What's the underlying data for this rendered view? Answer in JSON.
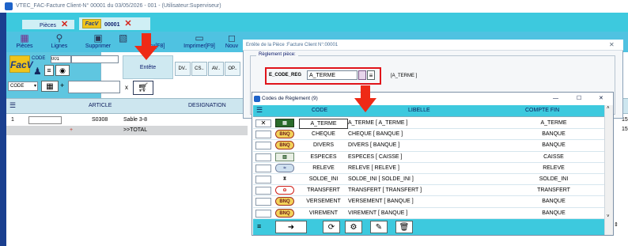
{
  "window": {
    "title": "VTEC_FAC-Facture Client-N° 00001 du 03/05/2026 - 001 - (Utilisateur:Superviseur)"
  },
  "tabs": [
    {
      "label": "Pièces"
    },
    {
      "label": "00001"
    }
  ],
  "toolbar": {
    "items": [
      {
        "label": "Pièces",
        "icon": "grid-icon"
      },
      {
        "label": "Lignes",
        "icon": "search-icon"
      },
      {
        "label": "Supprimer",
        "icon": "delete-icon"
      },
      {
        "label": "Reçu[F8]",
        "icon": "receipt-icon"
      },
      {
        "label": "Imprimer[F9]",
        "icon": "printer-icon"
      },
      {
        "label": "Nouv",
        "icon": "new-icon"
      }
    ]
  },
  "header_form": {
    "code_label": "CODE",
    "code_value": "001",
    "entete_label": "Entête",
    "mini_buttons": [
      "DV..",
      "CS..",
      "AV..",
      "OP.."
    ],
    "code_dropdown": "CODE"
  },
  "grid": {
    "columns": [
      "ARTICLE",
      "DESIGNATION"
    ],
    "rows": [
      {
        "num": "1",
        "article": "S0308",
        "designation": "Sable 3-8"
      },
      {
        "num": "",
        "article": "",
        "designation": ">>TOTAL"
      }
    ],
    "right_values": [
      "15",
      "15"
    ]
  },
  "entete_dialog": {
    "title": "Entête de la Pièce :Facture Client N°:00001",
    "section": "Règlement pièce:",
    "field_label": "E_CODE_REG",
    "field_value": "A_TERME",
    "field_display": "[A_TERME ]"
  },
  "codes_dialog": {
    "title": "Codes de Règlement (9)",
    "columns": [
      "CODE",
      "LIBELLE",
      "COMPTE FIN"
    ],
    "rows": [
      {
        "icon": "card-icon",
        "code": "A_TERME",
        "libelle": "A_TERME [ A_TERME ]",
        "compte": "A_TERME"
      },
      {
        "icon": "bnq-icon",
        "code": "CHEQUE",
        "libelle": "CHEQUE [ BANQUE ]",
        "compte": "BANQUE"
      },
      {
        "icon": "bnq-icon",
        "code": "DIVERS",
        "libelle": "DIVERS [ BANQUE ]",
        "compte": "BANQUE"
      },
      {
        "icon": "cash-icon",
        "code": "ESPECES",
        "libelle": "ESPECES [ CAISSE ]",
        "compte": "CAISSE"
      },
      {
        "icon": "releve-icon",
        "code": "RELEVE",
        "libelle": "RELEVE [ RELEVE ]",
        "compte": "RELEVE"
      },
      {
        "icon": "hourglass-icon",
        "code": "SOLDE_INI",
        "libelle": "SOLDE_INI [ SOLDE_INI ]",
        "compte": "SOLDE_INI"
      },
      {
        "icon": "transfer-icon",
        "code": "TRANSFERT",
        "libelle": "TRANSFERT [ TRANSFERT ]",
        "compte": "TRANSFERT"
      },
      {
        "icon": "bnq-icon",
        "code": "VERSEMENT",
        "libelle": "VERSEMENT [ BANQUE ]",
        "compte": "BANQUE"
      },
      {
        "icon": "bnq-icon",
        "code": "VIREMENT",
        "libelle": "VIREMENT [ BANQUE ]",
        "compte": "BANQUE"
      }
    ],
    "window_buttons": [
      "—",
      "☐",
      "✕"
    ]
  },
  "colors": {
    "accent": "#3dc9de",
    "highlight_border": "#e0141a",
    "arrow": "#ee2a16"
  }
}
